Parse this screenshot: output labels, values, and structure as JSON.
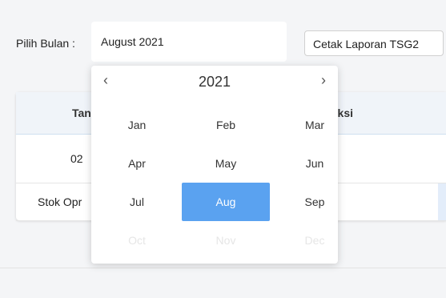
{
  "toolbar": {
    "month_label": "Pilih Bulan :",
    "month_value": "August 2021",
    "print_button": "Cetak Laporan TSG2"
  },
  "table": {
    "headers": [
      "Tan",
      "uksi"
    ],
    "rows": [
      [
        "02"
      ],
      [
        "Stok Opr"
      ]
    ]
  },
  "picker": {
    "year": "2021",
    "prev_icon": "‹",
    "next_icon": "›",
    "months": [
      {
        "label": "Jan",
        "state": "normal"
      },
      {
        "label": "Feb",
        "state": "normal"
      },
      {
        "label": "Mar",
        "state": "normal"
      },
      {
        "label": "Apr",
        "state": "normal"
      },
      {
        "label": "May",
        "state": "normal"
      },
      {
        "label": "Jun",
        "state": "normal"
      },
      {
        "label": "Jul",
        "state": "normal"
      },
      {
        "label": "Aug",
        "state": "selected"
      },
      {
        "label": "Sep",
        "state": "normal"
      },
      {
        "label": "Oct",
        "state": "disabled"
      },
      {
        "label": "Nov",
        "state": "disabled"
      },
      {
        "label": "Dec",
        "state": "disabled"
      }
    ],
    "selected_color": "#5aa2f0"
  }
}
